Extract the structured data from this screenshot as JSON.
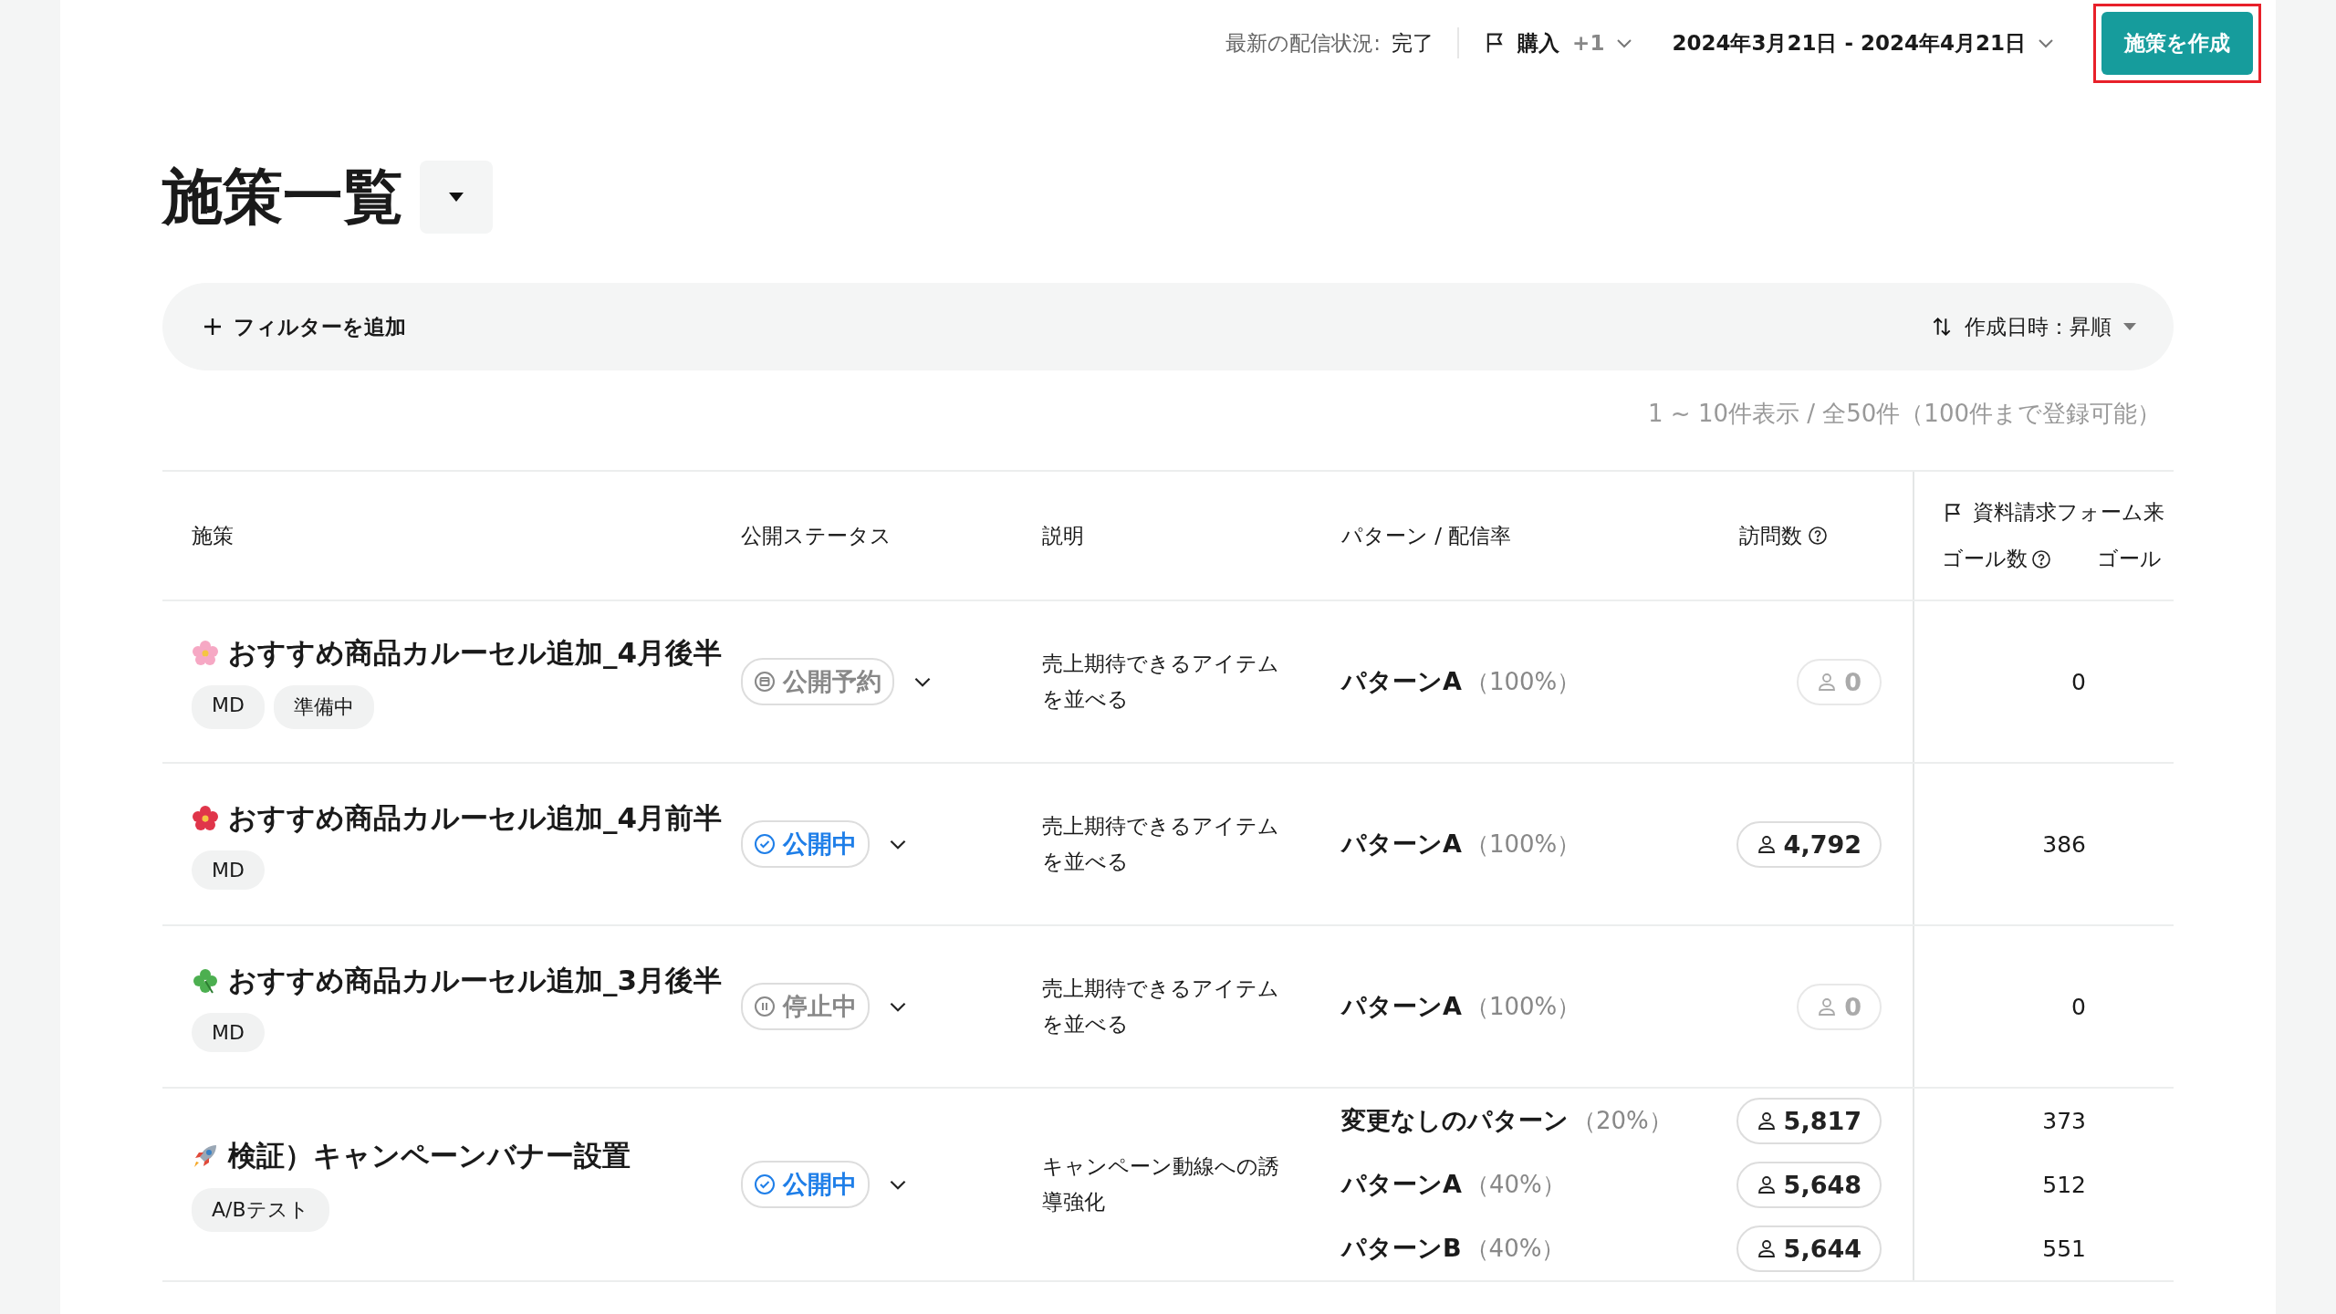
{
  "topbar": {
    "status_label": "最新の配信状況:",
    "status_value": "完了",
    "goal_label": "購入",
    "goal_extra": "+1",
    "date_range": "2024年3月21日 - 2024年4月21日",
    "create_button": "施策を作成",
    "button_highlighted": true
  },
  "title": "施策一覧",
  "filter": {
    "add_label": "フィルターを追加",
    "sort_label": "作成日時：昇順"
  },
  "count_text": "1 ~ 10件表示 / 全50件（100件まで登録可能）",
  "table": {
    "columns": [
      "施策",
      "公開ステータス",
      "説明",
      "パターン / 配信率",
      "訪問数"
    ],
    "goal_header": {
      "title": "資料請求フォーム来",
      "sub_columns": [
        "ゴール数",
        "ゴール"
      ]
    },
    "rows": [
      {
        "icon": {
          "kind": "flower",
          "color": "#f6a8c4"
        },
        "name": "おすすめ商品カルーセル追加_4月後半",
        "tags": [
          "MD",
          "準備中"
        ],
        "status": {
          "kind": "scheduled",
          "label": "公開予約"
        },
        "description": "売上期待できるアイテムを並べる",
        "patterns": [
          {
            "name": "パターンA",
            "rate": "（100%）",
            "visits": "0",
            "muted": true,
            "goals": "0"
          }
        ]
      },
      {
        "icon": {
          "kind": "flower",
          "color": "#e0354a"
        },
        "name": "おすすめ商品カルーセル追加_4月前半",
        "tags": [
          "MD"
        ],
        "status": {
          "kind": "live",
          "label": "公開中"
        },
        "description": "売上期待できるアイテムを並べる",
        "patterns": [
          {
            "name": "パターンA",
            "rate": "（100%）",
            "visits": "4,792",
            "muted": false,
            "goals": "386"
          }
        ]
      },
      {
        "icon": {
          "kind": "clover",
          "color": "#4caf50"
        },
        "name": "おすすめ商品カルーセル追加_3月後半",
        "tags": [
          "MD"
        ],
        "status": {
          "kind": "paused",
          "label": "停止中"
        },
        "description": "売上期待できるアイテムを並べる",
        "patterns": [
          {
            "name": "パターンA",
            "rate": "（100%）",
            "visits": "0",
            "muted": true,
            "goals": "0"
          }
        ]
      },
      {
        "icon": {
          "kind": "rocket",
          "color": "#9aa7b5"
        },
        "name": "検証）キャンペーンバナー設置",
        "tags": [
          "A/Bテスト"
        ],
        "status": {
          "kind": "live",
          "label": "公開中"
        },
        "description": "キャンペーン動線への誘導強化",
        "patterns": [
          {
            "name": "変更なしのパターン",
            "rate": "（20%）",
            "visits": "5,817",
            "muted": false,
            "goals": "373"
          },
          {
            "name": "パターンA",
            "rate": "（40%）",
            "visits": "5,648",
            "muted": false,
            "goals": "512"
          },
          {
            "name": "パターンB",
            "rate": "（40%）",
            "visits": "5,644",
            "muted": false,
            "goals": "551"
          }
        ]
      }
    ]
  }
}
